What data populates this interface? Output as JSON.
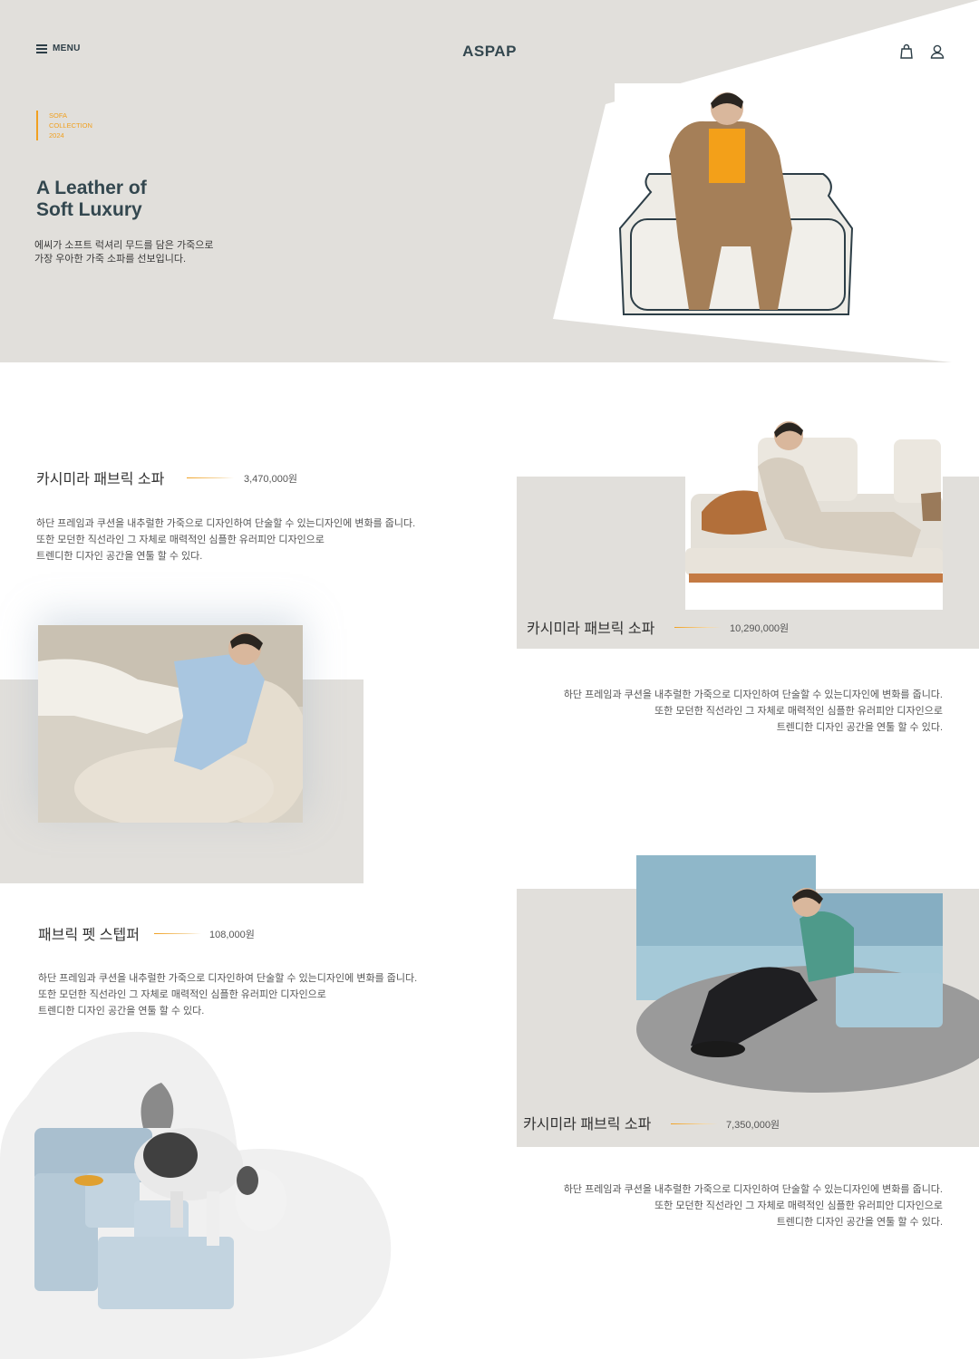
{
  "header": {
    "menu_label": "MENU",
    "logo": "ASPAP",
    "icons": [
      "bag-icon",
      "user-icon"
    ]
  },
  "hero": {
    "tag_lines": [
      "SOFA",
      "COLLECTION",
      "2024"
    ],
    "title_lines": [
      "A Leather of",
      "Soft Luxury"
    ],
    "desc_lines": [
      "에씨가 소프트 럭셔리 무드를 담은 가죽으로",
      "가장 우아한 가죽 소파를 선보입니다."
    ]
  },
  "products": [
    {
      "title": "카시미라 패브릭 소파",
      "price": "3,470,000원",
      "desc_lines": [
        "하단 프레임과 쿠션을 내추럴한 가죽으로 디자인하여 단술할 수 있는디자인에 변화를 줍니다.",
        "또한 모던한 직선라인 그 자체로 매력적인 심플한 유러피안 디자인으로",
        "트렌디한 디자인 공간을 연툴 할 수 있다."
      ]
    },
    {
      "title": "카시미라 패브릭 소파",
      "price": "10,290,000원",
      "desc_lines": [
        "하단 프레임과 쿠션을 내추럴한 가죽으로 디자인하여 단술할 수 있는디자인에 변화를 줍니다.",
        "또한 모던한 직선라인 그 자체로 매력적인 심플한 유러피안 디자인으로",
        "트렌디한 디자인 공간을 연툴 할 수 있다."
      ]
    },
    {
      "title": "패브릭 펫 스텝퍼",
      "price": "108,000원",
      "desc_lines": [
        "하단 프레임과 쿠션을 내추럴한 가죽으로 디자인하여 단술할 수 있는디자인에 변화를 줍니다.",
        "또한 모던한 직선라인 그 자체로 매력적인 심플한 유러피안 디자인으로",
        "트렌디한 디자인 공간을 연툴 할 수 있다."
      ]
    },
    {
      "title": "카시미라 패브릭 소파",
      "price": "7,350,000원",
      "desc_lines": [
        "하단 프레임과 쿠션을 내추럴한 가죽으로 디자인하여 단술할 수 있는디자인에 변화를 줍니다.",
        "또한 모던한 직선라인 그 자체로 매력적인 심플한 유러피안 디자인으로",
        "트렌디한 디자인 공간을 연툴 할 수 있다."
      ]
    }
  ],
  "colors": {
    "accent": "#f0a020",
    "brand_text": "#33474f",
    "panel_grey": "#e1dfdb"
  }
}
